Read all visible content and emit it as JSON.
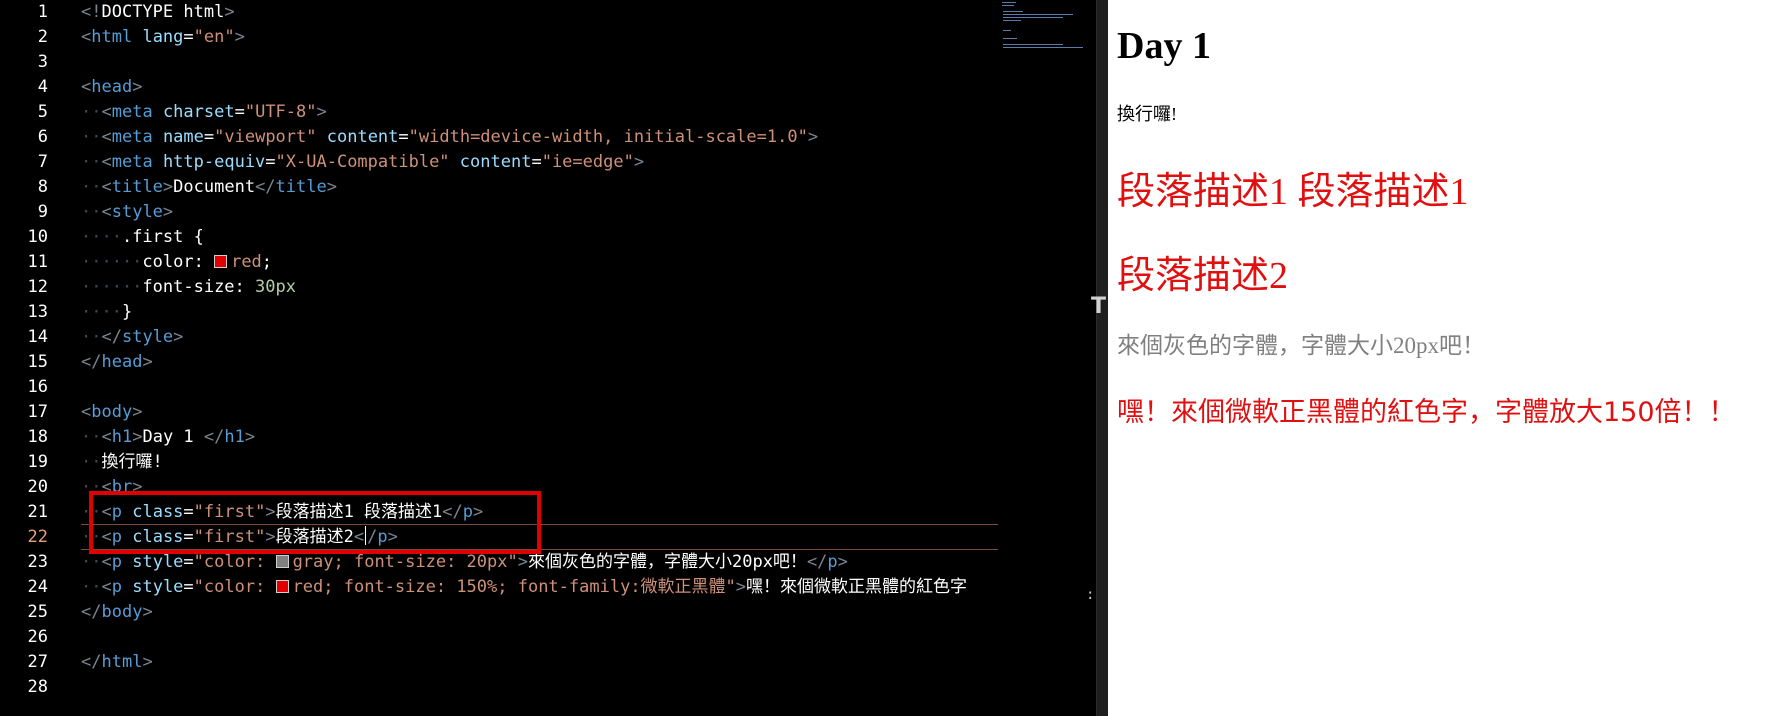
{
  "editor": {
    "current_line": "22",
    "lines": [
      {
        "n": "1",
        "parts": [
          [
            "bkt",
            "<!"
          ],
          [
            "txt",
            "DOCTYPE html"
          ],
          [
            "bkt",
            ">"
          ]
        ]
      },
      {
        "n": "2",
        "parts": [
          [
            "bkt",
            "<"
          ],
          [
            "tag",
            "html"
          ],
          [
            "txt",
            " "
          ],
          [
            "attr",
            "lang"
          ],
          [
            "txt",
            "="
          ],
          [
            "str",
            "\"en\""
          ],
          [
            "bkt",
            ">"
          ]
        ]
      },
      {
        "n": "3",
        "parts": []
      },
      {
        "n": "4",
        "parts": [
          [
            "bkt",
            "<"
          ],
          [
            "tag",
            "head"
          ],
          [
            "bkt",
            ">"
          ]
        ]
      },
      {
        "n": "5",
        "parts": [
          [
            "guide",
            "··"
          ],
          [
            "bkt",
            "<"
          ],
          [
            "tag",
            "meta"
          ],
          [
            "txt",
            " "
          ],
          [
            "attr",
            "charset"
          ],
          [
            "txt",
            "="
          ],
          [
            "str",
            "\"UTF-8\""
          ],
          [
            "bkt",
            ">"
          ]
        ]
      },
      {
        "n": "6",
        "parts": [
          [
            "guide",
            "··"
          ],
          [
            "bkt",
            "<"
          ],
          [
            "tag",
            "meta"
          ],
          [
            "txt",
            " "
          ],
          [
            "attr",
            "name"
          ],
          [
            "txt",
            "="
          ],
          [
            "str",
            "\"viewport\""
          ],
          [
            "txt",
            " "
          ],
          [
            "attr",
            "content"
          ],
          [
            "txt",
            "="
          ],
          [
            "str",
            "\"width=device-width, initial-scale=1.0\""
          ],
          [
            "bkt",
            ">"
          ]
        ]
      },
      {
        "n": "7",
        "parts": [
          [
            "guide",
            "··"
          ],
          [
            "bkt",
            "<"
          ],
          [
            "tag",
            "meta"
          ],
          [
            "txt",
            " "
          ],
          [
            "attr",
            "http-equiv"
          ],
          [
            "txt",
            "="
          ],
          [
            "str",
            "\"X-UA-Compatible\""
          ],
          [
            "txt",
            " "
          ],
          [
            "attr",
            "content"
          ],
          [
            "txt",
            "="
          ],
          [
            "str",
            "\"ie=edge\""
          ],
          [
            "bkt",
            ">"
          ]
        ]
      },
      {
        "n": "8",
        "parts": [
          [
            "guide",
            "··"
          ],
          [
            "bkt",
            "<"
          ],
          [
            "tag",
            "title"
          ],
          [
            "bkt",
            ">"
          ],
          [
            "txt",
            "Document"
          ],
          [
            "bkt",
            "</"
          ],
          [
            "tag",
            "title"
          ],
          [
            "bkt",
            ">"
          ]
        ]
      },
      {
        "n": "9",
        "parts": [
          [
            "guide",
            "··"
          ],
          [
            "bkt",
            "<"
          ],
          [
            "tag",
            "style"
          ],
          [
            "bkt",
            ">"
          ]
        ]
      },
      {
        "n": "10",
        "parts": [
          [
            "guide",
            "····"
          ],
          [
            "txt",
            ".first {"
          ]
        ]
      },
      {
        "n": "11",
        "parts": [
          [
            "guide",
            "······"
          ],
          [
            "txt",
            "color: "
          ],
          [
            "swatch",
            "#e00000"
          ],
          [
            "str",
            "red"
          ],
          [
            "txt",
            ";"
          ]
        ]
      },
      {
        "n": "12",
        "parts": [
          [
            "guide",
            "······"
          ],
          [
            "txt",
            "font-size: "
          ],
          [
            "num",
            "30px"
          ]
        ]
      },
      {
        "n": "13",
        "parts": [
          [
            "guide",
            "····"
          ],
          [
            "txt",
            "}"
          ]
        ]
      },
      {
        "n": "14",
        "parts": [
          [
            "guide",
            "··"
          ],
          [
            "bkt",
            "</"
          ],
          [
            "tag",
            "style"
          ],
          [
            "bkt",
            ">"
          ]
        ]
      },
      {
        "n": "15",
        "parts": [
          [
            "bkt",
            "</"
          ],
          [
            "tag",
            "head"
          ],
          [
            "bkt",
            ">"
          ]
        ]
      },
      {
        "n": "16",
        "parts": []
      },
      {
        "n": "17",
        "parts": [
          [
            "bkt",
            "<"
          ],
          [
            "tag",
            "body"
          ],
          [
            "bkt",
            ">"
          ]
        ]
      },
      {
        "n": "18",
        "parts": [
          [
            "guide",
            "··"
          ],
          [
            "bkt",
            "<"
          ],
          [
            "tag",
            "h1"
          ],
          [
            "bkt",
            ">"
          ],
          [
            "txt",
            "Day 1 "
          ],
          [
            "bkt",
            "</"
          ],
          [
            "tag",
            "h1"
          ],
          [
            "bkt",
            ">"
          ]
        ]
      },
      {
        "n": "19",
        "parts": [
          [
            "guide",
            "··"
          ],
          [
            "txt",
            "換行囉!"
          ]
        ]
      },
      {
        "n": "20",
        "parts": [
          [
            "guide",
            "··"
          ],
          [
            "bkt",
            "<"
          ],
          [
            "tag",
            "br"
          ],
          [
            "bkt",
            ">"
          ]
        ]
      },
      {
        "n": "21",
        "parts": [
          [
            "guide",
            "··"
          ],
          [
            "bkt",
            "<"
          ],
          [
            "tag",
            "p"
          ],
          [
            "txt",
            " "
          ],
          [
            "attr",
            "class"
          ],
          [
            "txt",
            "="
          ],
          [
            "str",
            "\"first\""
          ],
          [
            "bkt",
            ">"
          ],
          [
            "txt",
            "段落描述1 段落描述1"
          ],
          [
            "bkt",
            "</"
          ],
          [
            "tag",
            "p"
          ],
          [
            "bkt",
            ">"
          ]
        ]
      },
      {
        "n": "22",
        "parts": [
          [
            "guide",
            "··"
          ],
          [
            "bkt",
            "<"
          ],
          [
            "tag",
            "p"
          ],
          [
            "txt",
            " "
          ],
          [
            "attr",
            "class"
          ],
          [
            "txt",
            "="
          ],
          [
            "str",
            "\"first\""
          ],
          [
            "bkt",
            ">"
          ],
          [
            "txt",
            "段落描述2"
          ],
          [
            "bkt",
            "<"
          ],
          [
            "cursor",
            ""
          ],
          [
            "bkt",
            "/"
          ],
          [
            "tag",
            "p"
          ],
          [
            "bkt",
            ">"
          ]
        ]
      },
      {
        "n": "23",
        "parts": [
          [
            "guide",
            "··"
          ],
          [
            "bkt",
            "<"
          ],
          [
            "tag",
            "p"
          ],
          [
            "txt",
            " "
          ],
          [
            "attr",
            "style"
          ],
          [
            "txt",
            "="
          ],
          [
            "str",
            "\"color: "
          ],
          [
            "swatch",
            "#808080"
          ],
          [
            "str",
            "gray; font-size: 20px\""
          ],
          [
            "bkt",
            ">"
          ],
          [
            "txt",
            "來個灰色的字體，字體大小20px吧！"
          ],
          [
            "bkt",
            "</"
          ],
          [
            "tag",
            "p"
          ],
          [
            "bkt",
            ">"
          ]
        ]
      },
      {
        "n": "24",
        "parts": [
          [
            "guide",
            "··"
          ],
          [
            "bkt",
            "<"
          ],
          [
            "tag",
            "p"
          ],
          [
            "txt",
            " "
          ],
          [
            "attr",
            "style"
          ],
          [
            "txt",
            "="
          ],
          [
            "str",
            "\"color: "
          ],
          [
            "swatch",
            "#e00000"
          ],
          [
            "str",
            "red; font-size: 150%; font-family:微軟正黑體\""
          ],
          [
            "bkt",
            ">"
          ],
          [
            "txt",
            "嘿！來個微軟正黑體的紅色字"
          ]
        ]
      },
      {
        "n": "25",
        "parts": [
          [
            "bkt",
            "</"
          ],
          [
            "tag",
            "body"
          ],
          [
            "bkt",
            ">"
          ]
        ]
      },
      {
        "n": "26",
        "parts": []
      },
      {
        "n": "27",
        "parts": [
          [
            "bkt",
            "</"
          ],
          [
            "tag",
            "html"
          ],
          [
            "bkt",
            ">"
          ]
        ]
      },
      {
        "n": "28",
        "parts": []
      }
    ]
  },
  "preview": {
    "h1": "Day 1",
    "br_text": "換行囉!",
    "p1": "段落描述1 段落描述1",
    "p2": "段落描述2",
    "p3": "來個灰色的字體，字體大小20px吧！",
    "p4": "嘿！來個微軟正黑體的紅色字，字體放大150倍！！"
  }
}
